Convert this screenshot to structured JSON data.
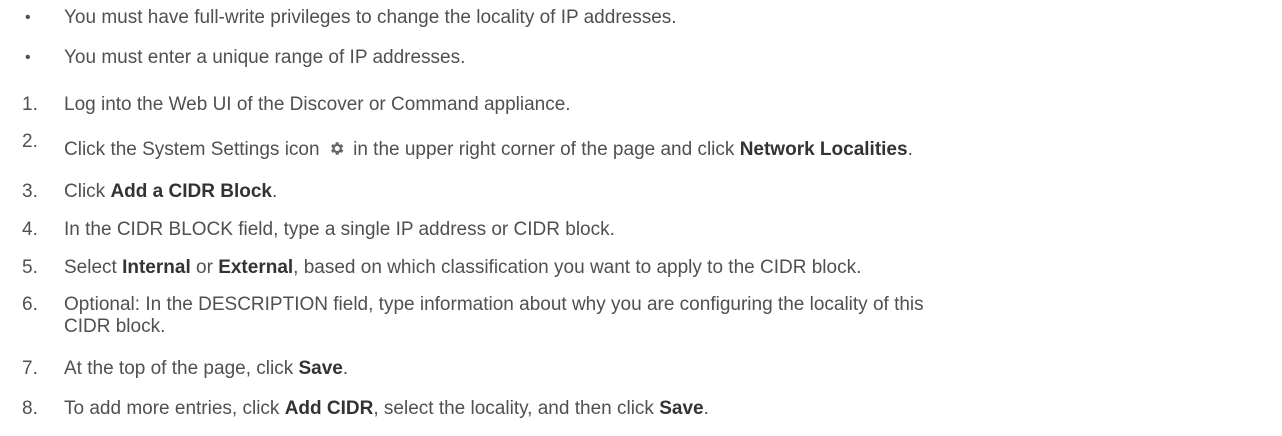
{
  "bullets": [
    "You must have full-write privileges to change the locality of IP addresses.",
    "You must enter a unique range of IP addresses."
  ],
  "steps": [
    {
      "num": "1.",
      "text": "Log into the Web UI of the Discover or Command appliance."
    },
    {
      "num": "2.",
      "before": "Click the System Settings icon",
      "after": "in the upper right corner of the page and click",
      "bold": "Network Localities",
      "end": ".",
      "icon": "gear-icon"
    },
    {
      "num": "3.",
      "before": "Click",
      "bold": "Add a CIDR Block",
      "end": "."
    },
    {
      "num": "4.",
      "text": "In the CIDR BLOCK field, type a single IP address or CIDR block."
    },
    {
      "num": "5.",
      "before": "Select",
      "bold": "Internal",
      "mid": "or",
      "bold2": "External",
      "after": ", based on which classification you want to apply to the CIDR block."
    },
    {
      "num": "6.",
      "line1": "Optional: In the DESCRIPTION field, type information about why you are configuring the locality of this",
      "line2": "CIDR block."
    },
    {
      "num": "7.",
      "before": "At the top of the page, click",
      "bold": "Save",
      "end": "."
    },
    {
      "num": "8.",
      "before": "To add more entries, click",
      "bold": "Add CIDR",
      "mid": ", select the locality, and then click",
      "bold2": "Save",
      "end": "."
    }
  ]
}
